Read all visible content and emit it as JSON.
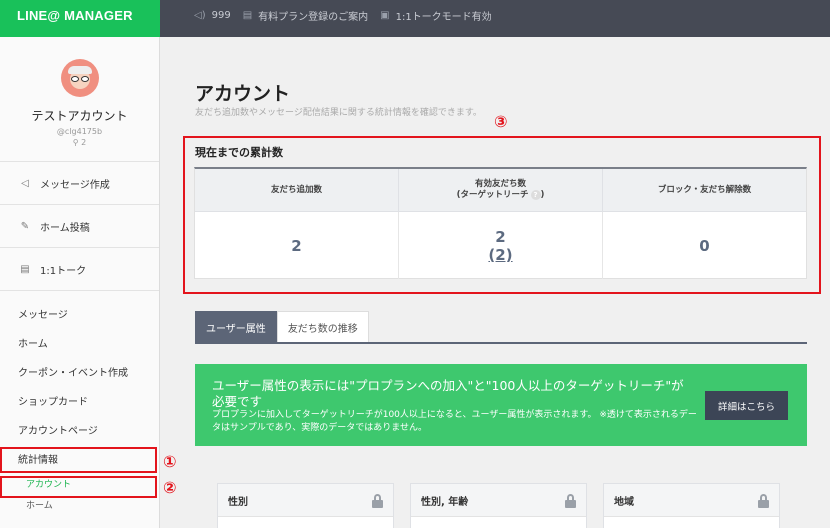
{
  "brand": {
    "logo": "LINE@ MANAGER",
    "accent": "#19c15a"
  },
  "topbar": [
    {
      "icon": "speaker-icon",
      "label": "999"
    },
    {
      "icon": "doc-icon",
      "label": "有料プラン登録のご案内"
    },
    {
      "icon": "chat-icon",
      "label": "1:1トークモード有効"
    }
  ],
  "profile": {
    "name": "テストアカウント",
    "id": "@clg4175b",
    "friends": "2"
  },
  "sidebar": {
    "main": [
      {
        "icon": "speaker-icon",
        "label": "メッセージ作成"
      },
      {
        "icon": "edit-icon",
        "label": "ホーム投稿"
      },
      {
        "icon": "chat-icon",
        "label": "1:1トーク"
      }
    ],
    "menu": [
      "メッセージ",
      "ホーム",
      "クーポン・イベント作成",
      "ショップカード",
      "アカウントページ",
      "統計情報"
    ],
    "children": [
      "アカウント",
      "ホーム"
    ]
  },
  "page": {
    "title": "アカウント",
    "desc": "友だち追加数やメッセージ配信結果に関する統計情報を確認できます。"
  },
  "stats": {
    "title": "現在までの累計数",
    "headers": [
      "友だち追加数",
      "有効友だち数",
      "ブロック・友だち解除数"
    ],
    "header2_sub": "(ターゲットリーチ",
    "header2_q": "?",
    "header2_close": ")",
    "values": [
      "2",
      "2",
      "0"
    ],
    "sub_value": "(2)"
  },
  "annotations": {
    "m1": "①",
    "m2": "②",
    "m3": "③"
  },
  "tabs": [
    "ユーザー属性",
    "友だち数の推移"
  ],
  "banner": {
    "headline": "ユーザー属性の表示には\"プロプランへの加入\"と\"100人以上のターゲットリーチ\"が必要です",
    "body": "プロプランに加入してターゲットリーチが100人以上になると、ユーザー属性が表示されます。 ※透けて表示されるデータはサンプルであり、実際のデータではありません。",
    "button": "詳細はこちら"
  },
  "cards": [
    "性別",
    "性別, 年齢",
    "地域"
  ]
}
